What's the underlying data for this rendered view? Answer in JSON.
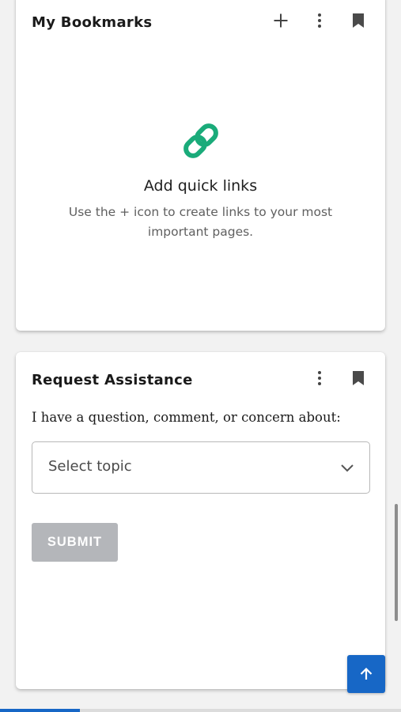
{
  "bookmarks_card": {
    "title": "My Bookmarks",
    "actions": {
      "add": "plus-icon",
      "more": "more-vertical-icon",
      "bookmark": "bookmark-icon"
    },
    "empty_state": {
      "icon": "link-icon",
      "title": "Add quick links",
      "description": "Use the + icon to create links to your most important pages."
    }
  },
  "assistance_card": {
    "title": "Request Assistance",
    "actions": {
      "more": "more-vertical-icon",
      "bookmark": "bookmark-icon"
    },
    "prompt": "I have a question, comment, or concern about:",
    "topic_select": {
      "value": "Select topic",
      "icon": "chevron-down-icon"
    },
    "submit_label": "SUBMIT"
  },
  "scroll_top_button": {
    "icon": "arrow-up-icon"
  },
  "page_progress": {
    "fraction": 0.2
  },
  "colors": {
    "accent_green": "#1aab7a",
    "accent_blue": "#1767c6",
    "disabled_button": "#b4b6ba"
  }
}
